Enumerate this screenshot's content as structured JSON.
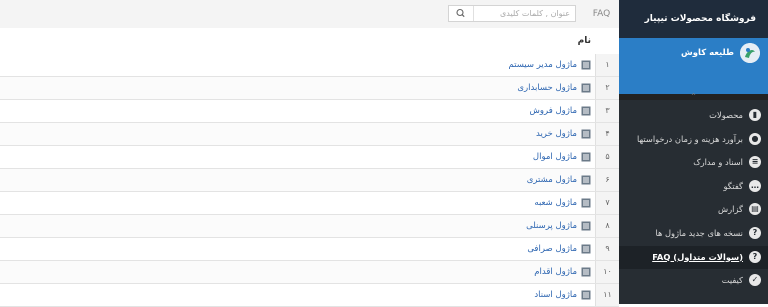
{
  "search": {
    "faq_label": "FAQ",
    "placeholder": "عنوان , کلمات کلیدی"
  },
  "table": {
    "header_name": "نام",
    "rows": [
      {
        "num": "۱",
        "label": "ماژول مدیر سیستم"
      },
      {
        "num": "۲",
        "label": "ماژول حسابداری"
      },
      {
        "num": "۳",
        "label": "ماژول فروش"
      },
      {
        "num": "۴",
        "label": "ماژول خرید"
      },
      {
        "num": "۵",
        "label": "ماژول اموال"
      },
      {
        "num": "۶",
        "label": "ماژول مشتری"
      },
      {
        "num": "۷",
        "label": "ماژول شعبه"
      },
      {
        "num": "۸",
        "label": "ماژول پرسنلی"
      },
      {
        "num": "۹",
        "label": "ماژول صرافی"
      },
      {
        "num": "۱۰",
        "label": "ماژول اقدام"
      },
      {
        "num": "۱۱",
        "label": "ماژول اسناد"
      }
    ]
  },
  "sidebar": {
    "brand": "فروشگاه محصولات تیپیار",
    "profile_name": "طلیعه کاوش",
    "menu": [
      {
        "label": "محصولات",
        "icon": "chart-icon"
      },
      {
        "label": "برآورد هزینه و زمان درخواستها",
        "icon": "users-icon"
      },
      {
        "label": "اسناد و مدارک",
        "icon": "document-icon"
      },
      {
        "label": "گفتگو",
        "icon": "chat-icon"
      },
      {
        "label": "گزارش",
        "icon": "report-icon"
      },
      {
        "label": "نسخه های جدید ماژول ها",
        "icon": "question-icon"
      },
      {
        "label": "FAQ (سوالات متداول)",
        "icon": "question-icon"
      },
      {
        "label": "کیفیت",
        "icon": "quality-icon"
      }
    ]
  },
  "colors": {
    "sidebar_bg": "#272d33",
    "brand_bg": "#1f2c3c",
    "profile_bg": "#2b7ec6",
    "link": "#2b64b0"
  }
}
